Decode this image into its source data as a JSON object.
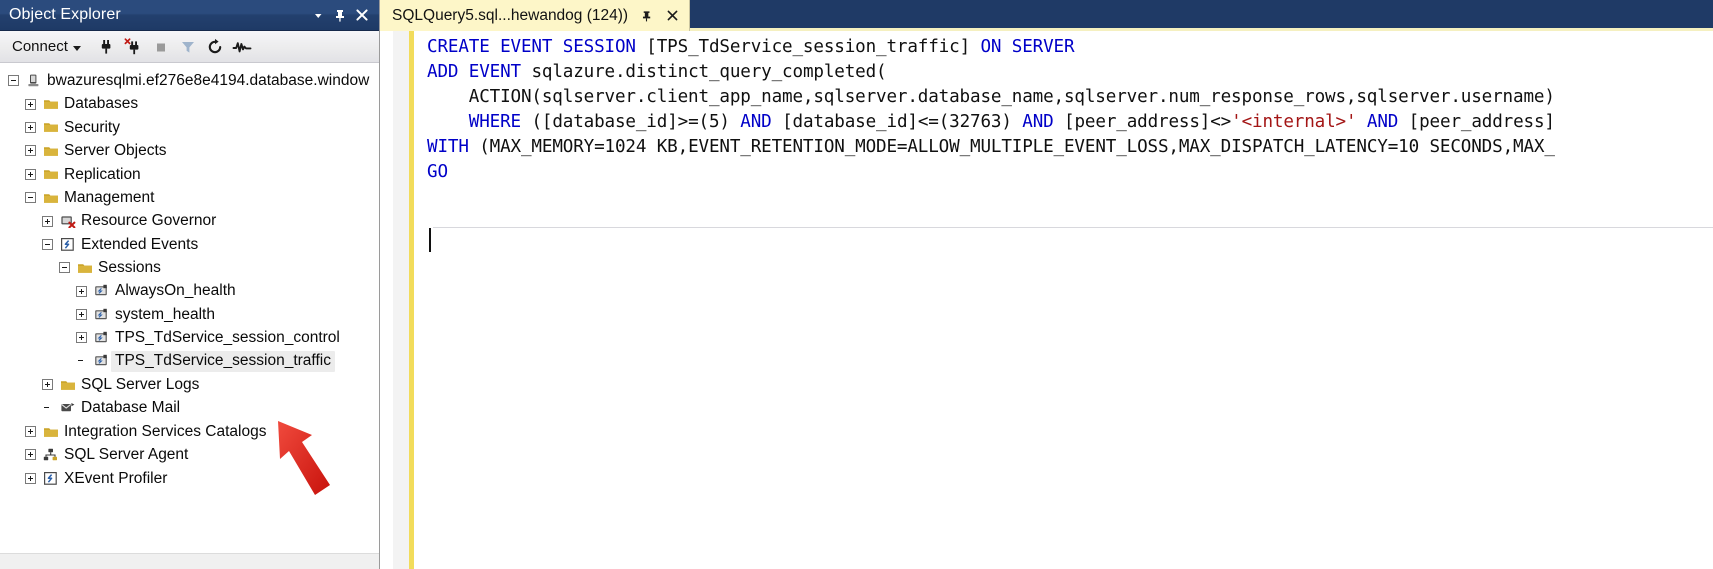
{
  "object_explorer": {
    "title": "Object Explorer",
    "titlebar_buttons": [
      {
        "name": "window-dropdown-icon",
        "glyph": "chevron-down-icon"
      },
      {
        "name": "auto-hide-pin-icon",
        "glyph": "pin-icon"
      },
      {
        "name": "close-panel-icon",
        "glyph": "close-icon"
      }
    ],
    "toolbar": {
      "connect_label": "Connect",
      "buttons": [
        {
          "name": "connect-icon",
          "tooltip": "Connect"
        },
        {
          "name": "disconnect-icon",
          "tooltip": "Disconnect"
        },
        {
          "name": "stop-icon",
          "tooltip": "Stop"
        },
        {
          "name": "filter-icon",
          "tooltip": "Filter"
        },
        {
          "name": "refresh-icon",
          "tooltip": "Refresh"
        },
        {
          "name": "activity-monitor-icon",
          "tooltip": "Activity Monitor"
        }
      ]
    },
    "tree": [
      {
        "label": "bwazuresqlmi.ef276e8e4194.database.window",
        "depth": 0,
        "expander": "minus",
        "icon": "server-icon",
        "selected": false
      },
      {
        "label": "Databases",
        "depth": 1,
        "expander": "plus",
        "icon": "folder-icon",
        "selected": false
      },
      {
        "label": "Security",
        "depth": 1,
        "expander": "plus",
        "icon": "folder-icon",
        "selected": false
      },
      {
        "label": "Server Objects",
        "depth": 1,
        "expander": "plus",
        "icon": "folder-icon",
        "selected": false
      },
      {
        "label": "Replication",
        "depth": 1,
        "expander": "plus",
        "icon": "folder-icon",
        "selected": false
      },
      {
        "label": "Management",
        "depth": 1,
        "expander": "minus",
        "icon": "folder-icon",
        "selected": false
      },
      {
        "label": "Resource Governor",
        "depth": 2,
        "expander": "plus",
        "icon": "resource-governor-icon",
        "selected": false
      },
      {
        "label": "Extended Events",
        "depth": 2,
        "expander": "minus",
        "icon": "extended-events-icon",
        "selected": false
      },
      {
        "label": "Sessions",
        "depth": 3,
        "expander": "minus",
        "icon": "folder-icon",
        "selected": false
      },
      {
        "label": "AlwaysOn_health",
        "depth": 4,
        "expander": "plus",
        "icon": "xevent-session-icon",
        "selected": false
      },
      {
        "label": "system_health",
        "depth": 4,
        "expander": "plus",
        "icon": "xevent-session-icon",
        "selected": false
      },
      {
        "label": "TPS_TdService_session_control",
        "depth": 4,
        "expander": "plus",
        "icon": "xevent-session-icon",
        "selected": false
      },
      {
        "label": "TPS_TdService_session_traffic",
        "depth": 4,
        "expander": "none",
        "icon": "xevent-session-icon",
        "selected": true
      },
      {
        "label": "SQL Server Logs",
        "depth": 2,
        "expander": "plus",
        "icon": "folder-icon",
        "selected": false
      },
      {
        "label": "Database Mail",
        "depth": 2,
        "expander": "none",
        "icon": "database-mail-icon",
        "selected": false
      },
      {
        "label": "Integration Services Catalogs",
        "depth": 1,
        "expander": "plus",
        "icon": "folder-icon",
        "selected": false
      },
      {
        "label": "SQL Server Agent",
        "depth": 1,
        "expander": "plus",
        "icon": "agent-icon",
        "selected": false
      },
      {
        "label": "XEvent Profiler",
        "depth": 1,
        "expander": "plus",
        "icon": "extended-events-icon",
        "selected": false
      }
    ],
    "annotation": {
      "name": "red-arrow-annotation",
      "color": "#e02b20",
      "points_at": "TPS_TdService_session_traffic"
    }
  },
  "editor": {
    "tab": {
      "label": "SQLQuery5.sql...hewandog (124))",
      "pin_icon": "pin-icon",
      "close_icon": "close-icon",
      "background": "#fdf6c8"
    },
    "colors": {
      "keyword": "#0000c8",
      "string": "#a31515",
      "text": "#101010",
      "change_bar": "#f2dc5b"
    },
    "code_lines": [
      {
        "id": "line-1",
        "fold": true,
        "segments": [
          {
            "t": "CREATE EVENT SESSION ",
            "c": "kw"
          },
          {
            "t": "[TPS_TdService_session_traffic] ",
            "c": ""
          },
          {
            "t": "ON SERVER",
            "c": "kw"
          }
        ]
      },
      {
        "id": "line-2",
        "fold": false,
        "segments": [
          {
            "t": "ADD EVENT ",
            "c": "kw"
          },
          {
            "t": "sqlazure.distinct_query_completed(",
            "c": ""
          }
        ]
      },
      {
        "id": "line-3",
        "fold": false,
        "segments": [
          {
            "t": "    ACTION(sqlserver.client_app_name,sqlserver.database_name,sqlserver.num_response_rows,sqlserver.username)",
            "c": ""
          }
        ]
      },
      {
        "id": "line-4",
        "fold": false,
        "segments": [
          {
            "t": "    ",
            "c": ""
          },
          {
            "t": "WHERE ",
            "c": "kw"
          },
          {
            "t": "([database_id]>=(5) ",
            "c": ""
          },
          {
            "t": "AND ",
            "c": "kw"
          },
          {
            "t": "[database_id]<=(32763) ",
            "c": ""
          },
          {
            "t": "AND ",
            "c": "kw"
          },
          {
            "t": "[peer_address]<>",
            "c": ""
          },
          {
            "t": "'<internal>'",
            "c": "str"
          },
          {
            "t": " ",
            "c": ""
          },
          {
            "t": "AND ",
            "c": "kw"
          },
          {
            "t": "[peer_address]",
            "c": ""
          }
        ]
      },
      {
        "id": "line-5",
        "fold": false,
        "segments": [
          {
            "t": "WITH ",
            "c": "kw"
          },
          {
            "t": "(MAX_MEMORY=1024 KB,EVENT_RETENTION_MODE=ALLOW_MULTIPLE_EVENT_LOSS,MAX_DISPATCH_LATENCY=10 SECONDS,MAX_",
            "c": ""
          }
        ]
      },
      {
        "id": "line-6",
        "fold": false,
        "segments": [
          {
            "t": "GO",
            "c": "kw"
          }
        ]
      }
    ],
    "caret": {
      "visible": true,
      "line": "empty-line-below-go"
    }
  }
}
